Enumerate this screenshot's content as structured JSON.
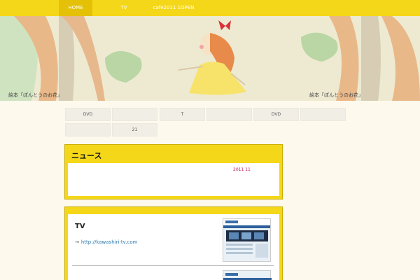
{
  "nav": {
    "items": [
      {
        "label": "HOME",
        "active": true
      },
      {
        "label": "TV",
        "active": false
      },
      {
        "label": "cafe2011 1OPEN",
        "active": false
      }
    ]
  },
  "hero": {
    "caption_left": "絵本「ぽんとうのお花」",
    "caption_right": "絵本「ぽんとうのお花」"
  },
  "grid": [
    "DVD",
    "",
    "T",
    "",
    "DVD",
    "",
    "",
    "21"
  ],
  "news": {
    "title": "ニュース",
    "date": "2011 11"
  },
  "tv": {
    "title": "TV",
    "arrow": "→",
    "link": "http://kawashiri-tv.com"
  },
  "colors": {
    "accent": "#f5d719",
    "background": "#fdf9ec",
    "link": "#2a7ab0",
    "date": "#c2185b"
  }
}
